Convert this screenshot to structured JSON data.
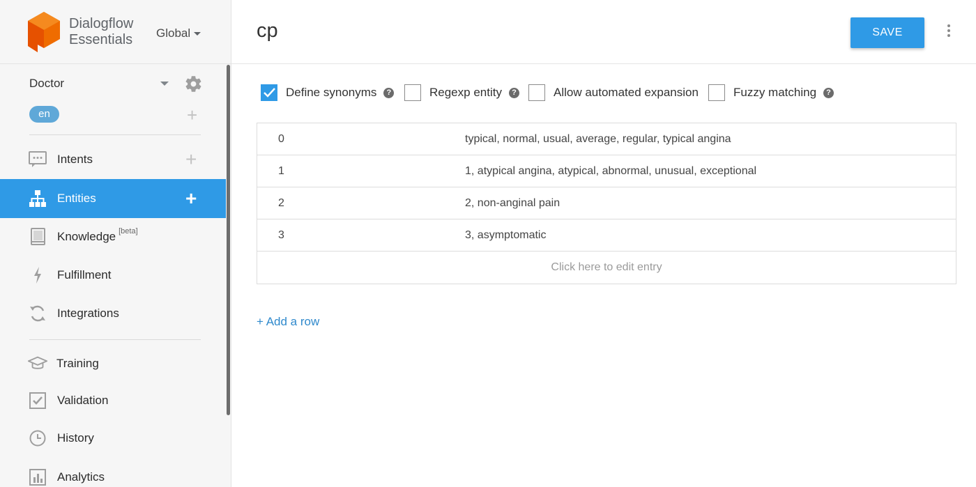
{
  "brand": {
    "line1": "Dialogflow",
    "line2": "Essentials",
    "region": "Global",
    "logo_color": "#ef6c00"
  },
  "agent": {
    "name": "Doctor",
    "language": "en"
  },
  "nav": {
    "intents": "Intents",
    "entities": "Entities",
    "knowledge": "Knowledge",
    "knowledge_badge": "[beta]",
    "fulfillment": "Fulfillment",
    "integrations": "Integrations",
    "training": "Training",
    "validation": "Validation",
    "history": "History",
    "analytics": "Analytics",
    "active": "entities"
  },
  "entity": {
    "title": "cp",
    "save_label": "SAVE"
  },
  "options": {
    "define_synonyms": {
      "label": "Define synonyms",
      "checked": true
    },
    "regexp_entity": {
      "label": "Regexp entity",
      "checked": false
    },
    "allow_expansion": {
      "label": "Allow automated expansion",
      "checked": false
    },
    "fuzzy_matching": {
      "label": "Fuzzy matching",
      "checked": false
    }
  },
  "entries": [
    {
      "value": "0",
      "synonyms": "typical, normal, usual, average, regular, typical angina"
    },
    {
      "value": "1",
      "synonyms": "1, atypical angina, atypical, abnormal, unusual, exceptional"
    },
    {
      "value": "2",
      "synonyms": "2, non-anginal pain"
    },
    {
      "value": "3",
      "synonyms": "3, asymptomatic"
    }
  ],
  "edit_hint": "Click here to edit entry",
  "add_row": "+ Add a row",
  "colors": {
    "accent": "#2f9ae6",
    "link": "#2f89cc",
    "sidebar_bg": "#f6f6f6"
  }
}
